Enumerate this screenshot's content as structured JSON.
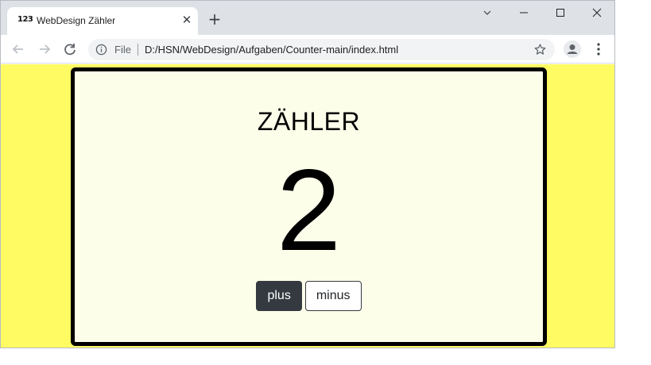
{
  "browser": {
    "tab": {
      "favicon_text": "123",
      "title": "WebDesign Zähler"
    },
    "omnibox": {
      "scheme_label": "File",
      "url": "D:/HSN/WebDesign/Aufgaben/Counter-main/index.html"
    }
  },
  "page": {
    "background_color": "#fffb63",
    "card_color": "#fcfee9",
    "heading": "ZÄHLER",
    "count": "2",
    "buttons": {
      "plus_label": "plus",
      "minus_label": "minus"
    }
  }
}
